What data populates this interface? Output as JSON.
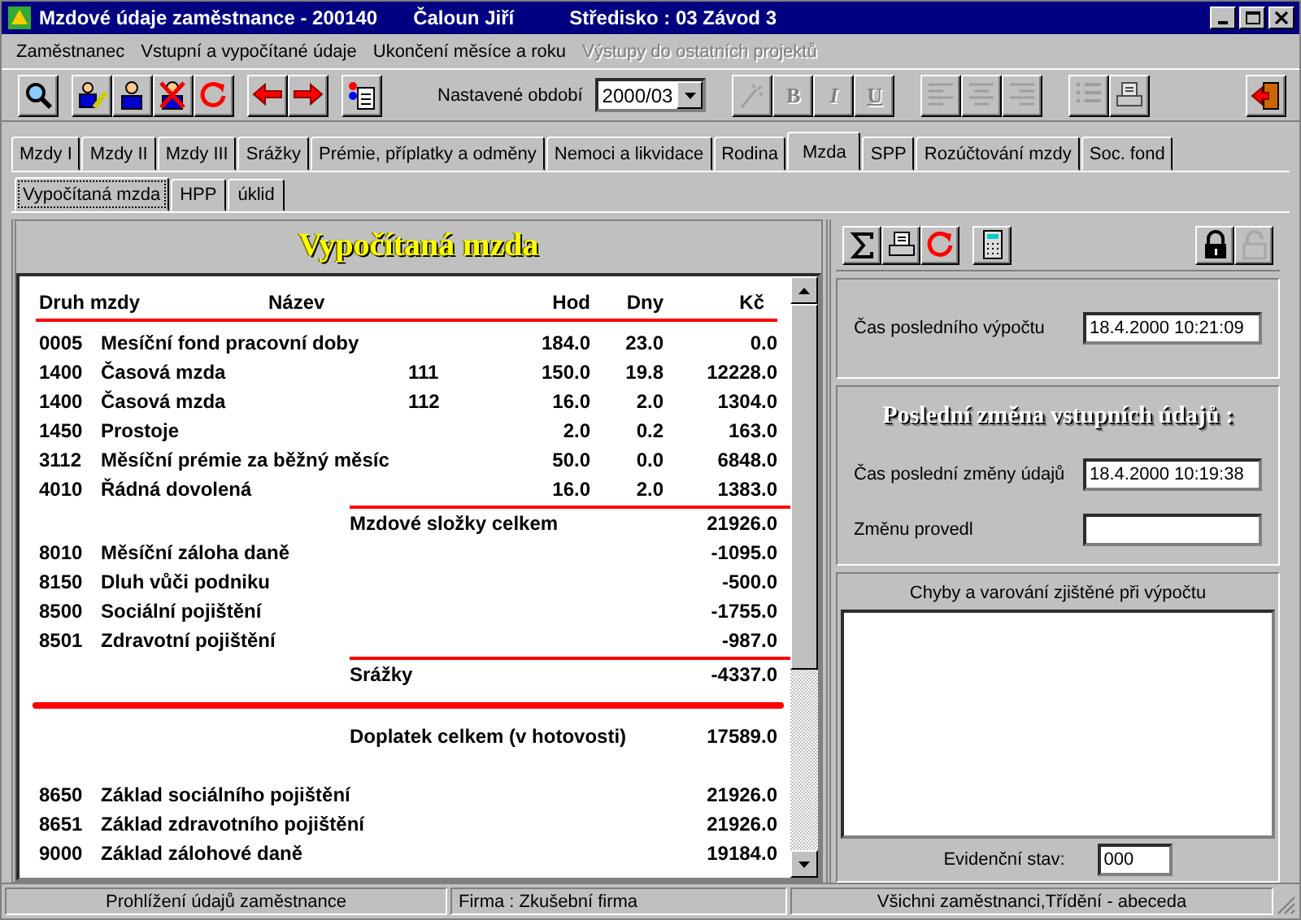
{
  "window": {
    "title": "Mzdové údaje zaměstnance - 200140",
    "employee": "Čaloun Jiří",
    "center": "Středisko : 03 Závod 3"
  },
  "menu": [
    {
      "label": "Zaměstnanec",
      "disabled": false
    },
    {
      "label": "Vstupní a vypočítané údaje",
      "disabled": false
    },
    {
      "label": "Ukončení měsíce a roku",
      "disabled": false
    },
    {
      "label": "Výstupy do ostatních projektů",
      "disabled": true
    }
  ],
  "toolbar": {
    "period_label": "Nastavené období",
    "period_value": "2000/03",
    "format_buttons": [
      {
        "label": "B",
        "disabled": true
      },
      {
        "label": "I",
        "disabled": true
      },
      {
        "label": "U",
        "disabled": true
      }
    ]
  },
  "tabs": [
    {
      "label": "Mzdy I",
      "selected": false
    },
    {
      "label": "Mzdy II",
      "selected": false
    },
    {
      "label": "Mzdy III",
      "selected": false
    },
    {
      "label": "Srážky",
      "selected": false
    },
    {
      "label": "Prémie, příplatky a odměny",
      "selected": false
    },
    {
      "label": "Nemoci a likvidace",
      "selected": false
    },
    {
      "label": "Rodina",
      "selected": false
    },
    {
      "label": "Mzda",
      "selected": true
    },
    {
      "label": "SPP",
      "selected": false
    },
    {
      "label": "Rozúčtování mzdy",
      "selected": false
    },
    {
      "label": "Soc. fond",
      "selected": false
    }
  ],
  "subtabs": [
    {
      "label": "Vypočítaná mzda",
      "selected": true
    },
    {
      "label": "HPP",
      "selected": false
    },
    {
      "label": "úklid",
      "selected": false
    }
  ],
  "report": {
    "title": "Vypočítaná mzda",
    "columns": [
      "Druh mzdy",
      "Název",
      "Hod",
      "Dny",
      "Kč"
    ],
    "rows": [
      {
        "kind": "item",
        "code": "0005",
        "name": "Mesíční fond pracovní doby",
        "hod": "184.0",
        "dny": "23.0",
        "kc": "0.0"
      },
      {
        "kind": "item",
        "code": "1400",
        "name": "Časová mzda",
        "extra": "111",
        "hod": "150.0",
        "dny": "19.8",
        "kc": "12228.0"
      },
      {
        "kind": "item",
        "code": "1400",
        "name": "Časová mzda",
        "extra": "112",
        "hod": "16.0",
        "dny": "2.0",
        "kc": "1304.0"
      },
      {
        "kind": "item",
        "code": "1450",
        "name": "Prostoje",
        "hod": "2.0",
        "dny": "0.2",
        "kc": "163.0"
      },
      {
        "kind": "item",
        "code": "3112",
        "name": "Měsíční prémie za běžný měsíc",
        "hod": "50.0",
        "dny": "0.0",
        "kc": "6848.0"
      },
      {
        "kind": "item",
        "code": "4010",
        "name": "Řádná dovolená",
        "hod": "16.0",
        "dny": "2.0",
        "kc": "1383.0"
      },
      {
        "kind": "total",
        "name": "Mzdové složky celkem",
        "kc": "21926.0"
      },
      {
        "kind": "item",
        "code": "8010",
        "name": "Měsíční záloha daně",
        "kc": "-1095.0"
      },
      {
        "kind": "item",
        "code": "8150",
        "name": "Dluh vůči podniku",
        "kc": "-500.0"
      },
      {
        "kind": "item",
        "code": "8500",
        "name": "Sociální pojištění",
        "kc": "-1755.0"
      },
      {
        "kind": "item",
        "code": "8501",
        "name": "Zdravotní pojištění",
        "kc": "-987.0"
      },
      {
        "kind": "total",
        "name": "Srážky",
        "kc": "-4337.0"
      },
      {
        "kind": "net",
        "name": "Doplatek celkem (v hotovosti)",
        "kc": "17589.0"
      },
      {
        "kind": "item",
        "code": "8650",
        "name": "Základ sociálního pojištění",
        "kc": "21926.0"
      },
      {
        "kind": "item",
        "code": "8651",
        "name": "Základ zdravotního pojištění",
        "kc": "21926.0"
      },
      {
        "kind": "item",
        "code": "9000",
        "name": "Základ zálohové daně",
        "kc": "19184.0"
      }
    ]
  },
  "side": {
    "last_calc_label": "Čas posledního výpočtu",
    "last_calc_value": "18.4.2000 10:21:09",
    "change_heading": "Poslední změna vstupních údajů :",
    "last_change_label": "Čas poslední změny údajů",
    "last_change_value": "18.4.2000 10:19:38",
    "changed_by_label": "Změnu provedl",
    "errors_label": "Chyby a varování zjištěné při výpočtu",
    "status_label": "Evidenční stav:",
    "status_value": "000"
  },
  "status_bar": [
    "Prohlížení údajů zaměstnance",
    "Firma :  Zkušební firma",
    "Všichni zaměstnanci,Třídění - abeceda"
  ]
}
